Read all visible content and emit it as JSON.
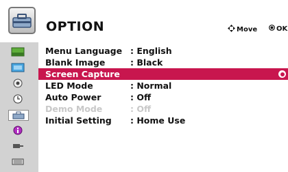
{
  "header": {
    "icon": "toolbox-icon",
    "title": "OPTION",
    "move_hint": "Move",
    "ok_hint": "OK"
  },
  "sidebar": {
    "icons": [
      "picture-icon",
      "screen-icon",
      "audio-icon",
      "time-icon",
      "option-icon",
      "info-icon",
      "input-icon",
      "usb-icon"
    ]
  },
  "menu": {
    "items": [
      {
        "label": "Menu Language",
        "value": ": English"
      },
      {
        "label": "Blank Image",
        "value": ": Black"
      },
      {
        "label": "Screen Capture",
        "value": ""
      },
      {
        "label": "LED Mode",
        "value": ": Normal"
      },
      {
        "label": "Auto Power",
        "value": ": Off"
      },
      {
        "label": "Demo Mode",
        "value": ": Off"
      },
      {
        "label": "Initial Setting",
        "value": ": Home Use"
      }
    ]
  },
  "colors": {
    "highlight": "#c8164e",
    "sidebar": "#d2d2d2",
    "disabled_text": "#c8c8c8"
  }
}
